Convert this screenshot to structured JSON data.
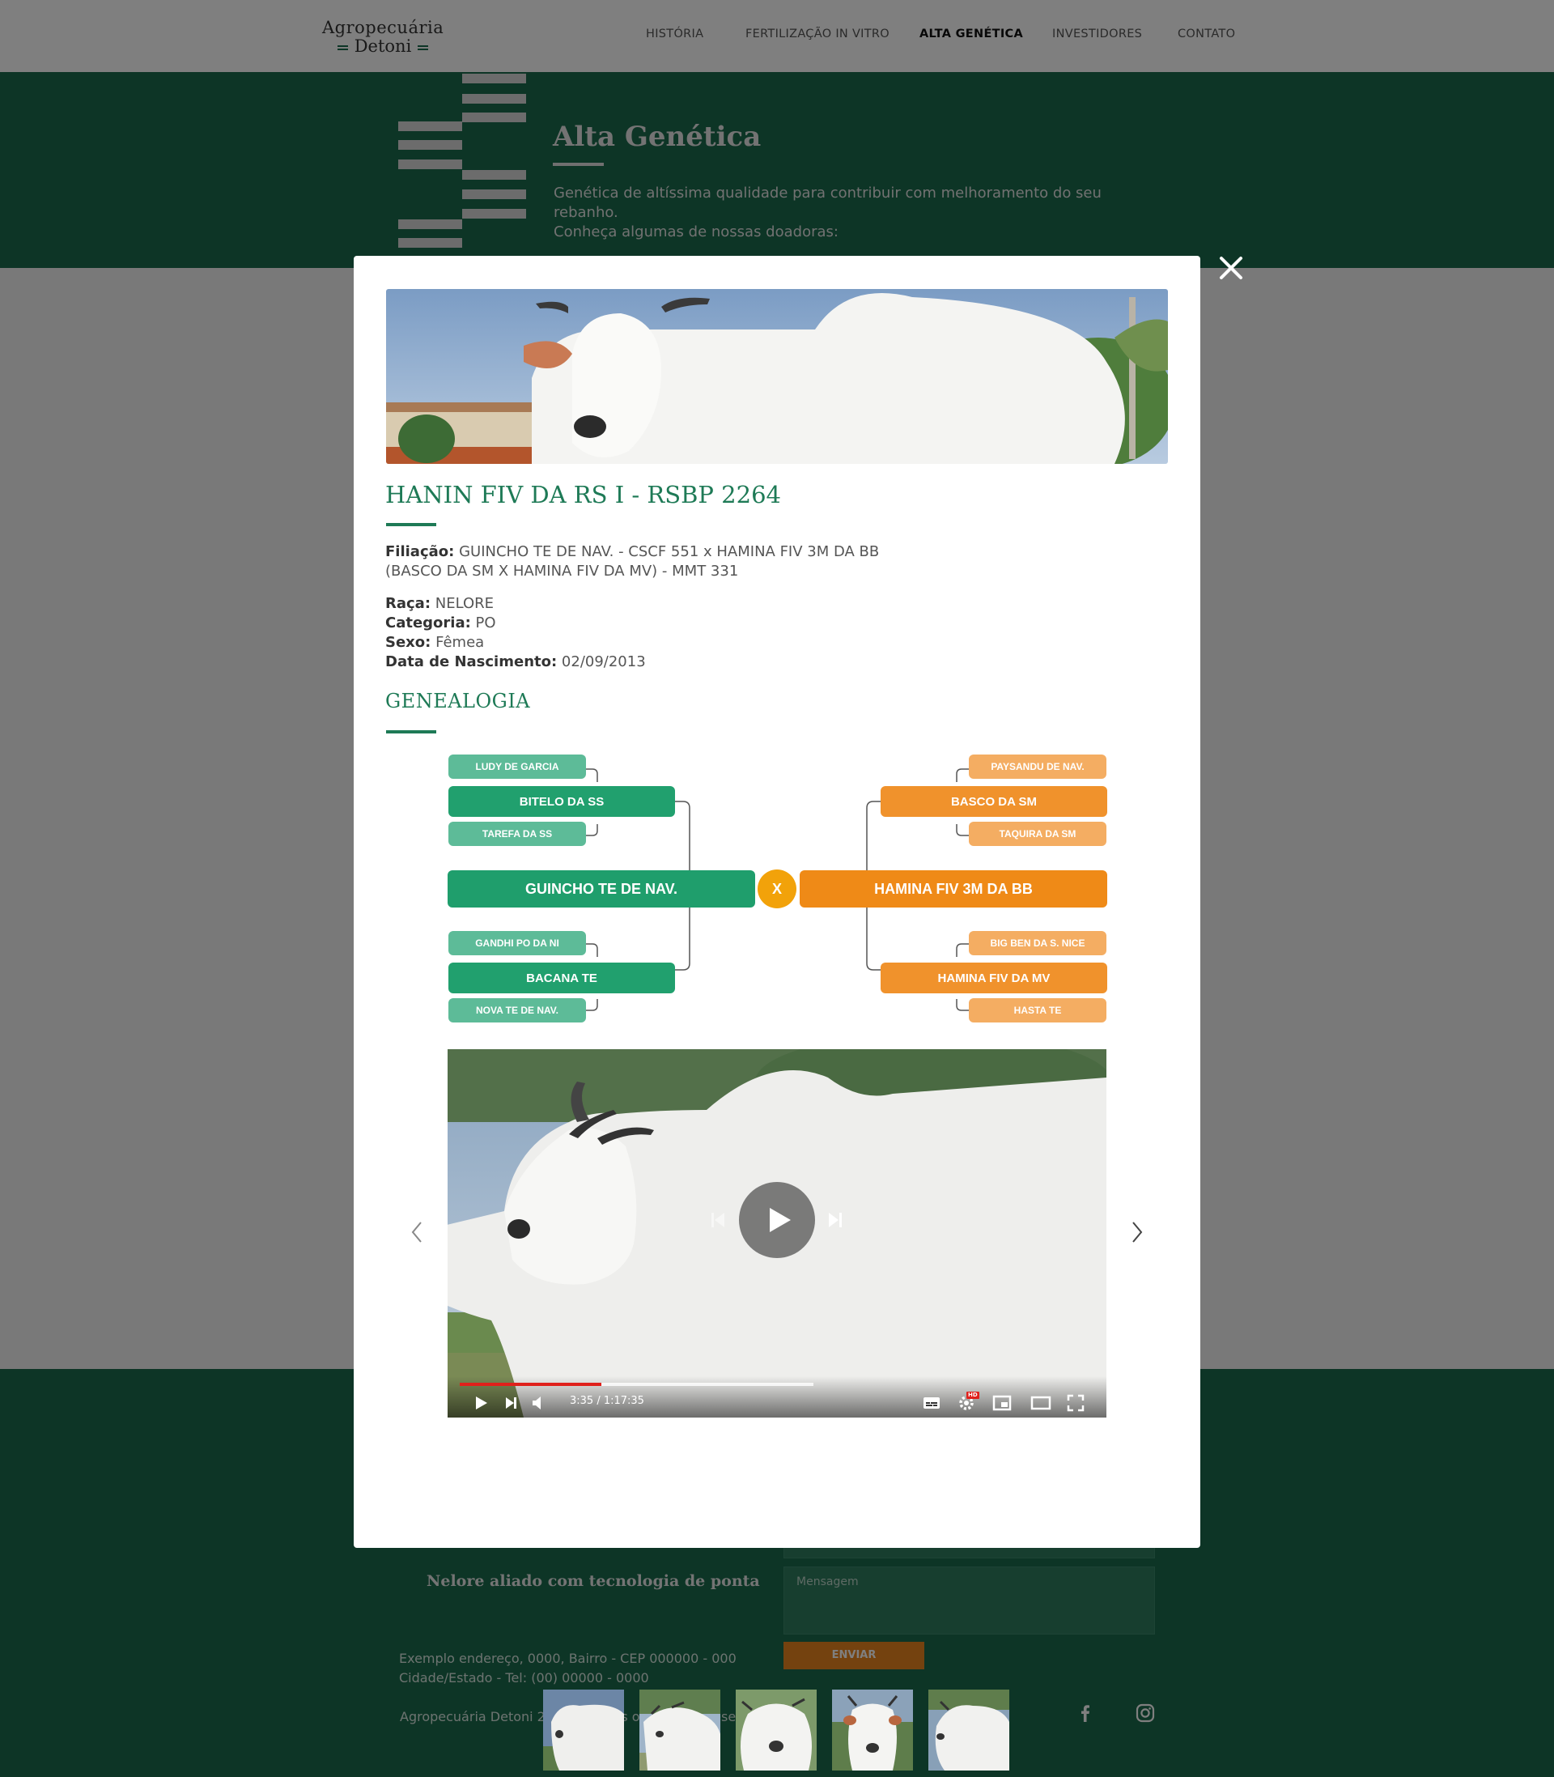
{
  "header": {
    "logo_line1": "Agropecuária",
    "logo_line2": "Detoni",
    "nav": [
      {
        "label": "HISTÓRIA"
      },
      {
        "label": "FERTILIZAÇÃO IN VITRO"
      },
      {
        "label": "ALTA GENÉTICA",
        "active": true
      },
      {
        "label": "INVESTIDORES"
      },
      {
        "label": "CONTATO"
      }
    ]
  },
  "hero": {
    "title": "Alta Genética",
    "subtitle_line1": "Genética de altíssima qualidade para contribuir com melhoramento do seu rebanho.",
    "subtitle_line2": "Conheça algumas de nossas doadoras:"
  },
  "modal": {
    "title": "HANIN FIV DA RS I - RSBP 2264",
    "filiacao_label": "Filiação:",
    "filiacao_value": "GUINCHO TE DE NAV. - CSCF 551 x HAMINA FIV 3M DA BB (BASCO DA SM X HAMINA FIV DA MV) - MMT 331",
    "details": [
      {
        "label": "Raça:",
        "value": "NELORE"
      },
      {
        "label": "Categoria:",
        "value": "PO"
      },
      {
        "label": "Sexo:",
        "value": "Fêmea"
      },
      {
        "label": "Data de Nascimento:",
        "value": "02/09/2013"
      }
    ],
    "genealogy_title": "GENEALOGIA",
    "genealogy": {
      "sire": "GUINCHO TE DE NAV.",
      "dam": "HAMINA FIV 3M DA BB",
      "cross": "X",
      "sire_sire": "BITELO DA SS",
      "sire_sire_sire": "LUDY DE GARCIA",
      "sire_sire_dam": "TAREFA DA SS",
      "sire_dam": "BACANA TE",
      "sire_dam_sire": "GANDHI PO DA NI",
      "sire_dam_dam": "NOVA TE DE NAV.",
      "dam_sire": "BASCO DA SM",
      "dam_sire_sire": "PAYSANDU DE NAV.",
      "dam_sire_dam": "TAQUIRA DA SM",
      "dam_dam": "HAMINA FIV DA MV",
      "dam_dam_sire": "BIG BEN DA S. NICE",
      "dam_dam_dam": "HASTA TE"
    },
    "video": {
      "time": "3:35 / 1:17:35",
      "progress": 0.226,
      "buffered": 0.564,
      "hd_badge": "HD"
    },
    "thumbnails_count": 5
  },
  "footer": {
    "tagline": "Nelore aliado com tecnologia de ponta",
    "message_placeholder": "Mensagem",
    "send_label": "ENVIAR",
    "address_line1": "Exemplo endereço, 0000, Bairro - CEP 000000 - 000",
    "address_line2": "Cidade/Estado - Tel: (00) 00000 - 0000",
    "copyright": "Agropecuária Detoni 2021 © Todos os Direitos Reservados."
  },
  "colors": {
    "brand_green": "#1b6b4c",
    "accent_orange": "#ef8a17",
    "sire_green": "#1f9e6c",
    "progress_red": "#e0201b"
  }
}
